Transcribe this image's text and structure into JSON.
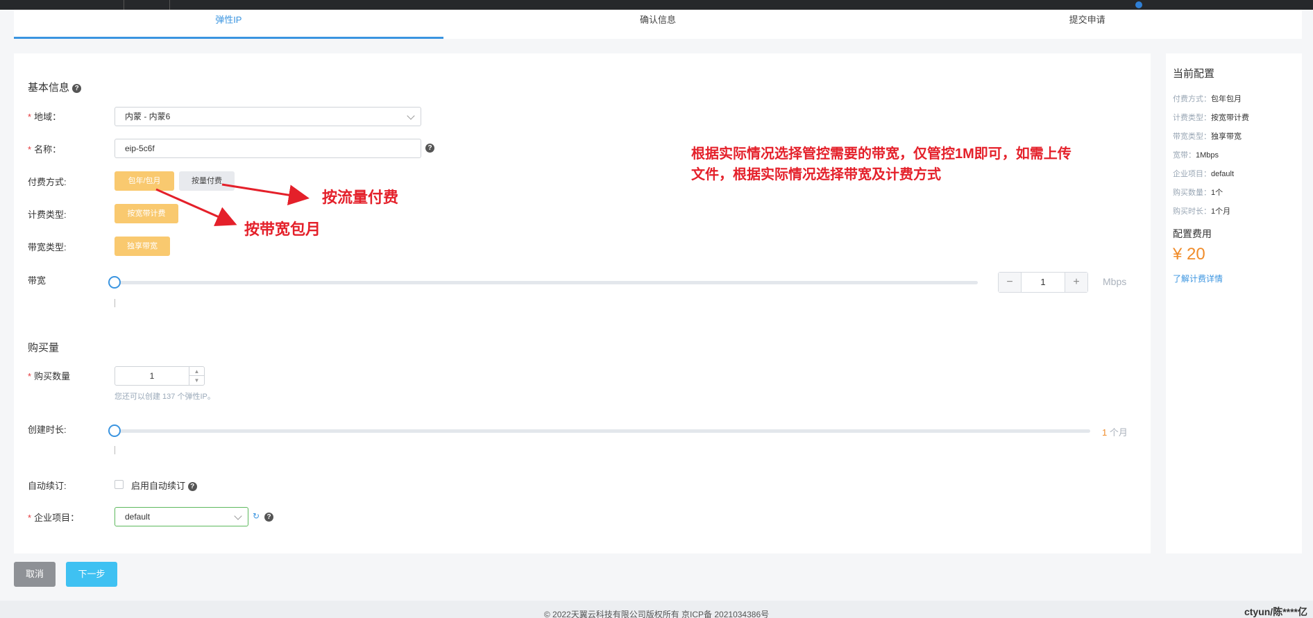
{
  "steps": [
    {
      "label": "弹性IP"
    },
    {
      "label": "确认信息"
    },
    {
      "label": "提交申请"
    }
  ],
  "basic": {
    "section_title": "基本信息",
    "region_label": "地域：",
    "region_value": "内蒙 - 内蒙6",
    "name_label": "名称：",
    "name_value": "eip-5c6f",
    "pay_label": "付费方式:",
    "pay_option_monthly": "包年/包月",
    "pay_option_traffic": "按量付费",
    "billing_label": "计费类型:",
    "billing_value": "按宽带计费",
    "bw_type_label": "带宽类型:",
    "bw_type_value": "独享带宽",
    "bandwidth_label": "带宽",
    "bandwidth_value": "1",
    "bandwidth_unit": "Mbps",
    "bandwidth_minus": "−",
    "bandwidth_plus": "+"
  },
  "purchase": {
    "section_title": "购买量",
    "qty_label": "购买数量",
    "qty_value": "1",
    "qty_hint": "您还可以创建 137 个弹性IP。",
    "duration_label": "创建时长:",
    "duration_value": "1",
    "duration_unit": "个月",
    "autorenew_label": "自动续订:",
    "autorenew_text": "启用自动续订",
    "project_label": "企业项目：",
    "project_value": "default"
  },
  "annotations": {
    "main_note_line1": "根据实际情况选择管控需要的带宽，仅管控1M即可，如需上传",
    "main_note_line2": "文件，根据实际情况选择带宽及计费方式",
    "traffic_note": "按流量付费",
    "monthly_note": "按带宽包月"
  },
  "sidebar": {
    "title": "当前配置",
    "rows": [
      {
        "k": "付费方式：",
        "v": "包年包月"
      },
      {
        "k": "计费类型：",
        "v": "按宽带计费"
      },
      {
        "k": "带宽类型：",
        "v": "独享带宽"
      },
      {
        "k": "宽带：",
        "v": "1Mbps"
      },
      {
        "k": "企业项目：",
        "v": "default"
      },
      {
        "k": "购买数量：",
        "v": "1个"
      },
      {
        "k": "购买时长：",
        "v": "1个月"
      }
    ],
    "fee_title": "配置费用",
    "price": "¥ 20",
    "link": "了解计费详情"
  },
  "actions": {
    "cancel": "取消",
    "next": "下一步"
  },
  "footer": {
    "text": "© 2022天翼云科技有限公司版权所有 京ICP备 2021034386号",
    "watermark": "ctyun/陈****亿"
  },
  "colors": {
    "accent": "#3a94e0",
    "chip": "#f9c96f",
    "price": "#f08c2a",
    "annotation": "#e4202a"
  }
}
